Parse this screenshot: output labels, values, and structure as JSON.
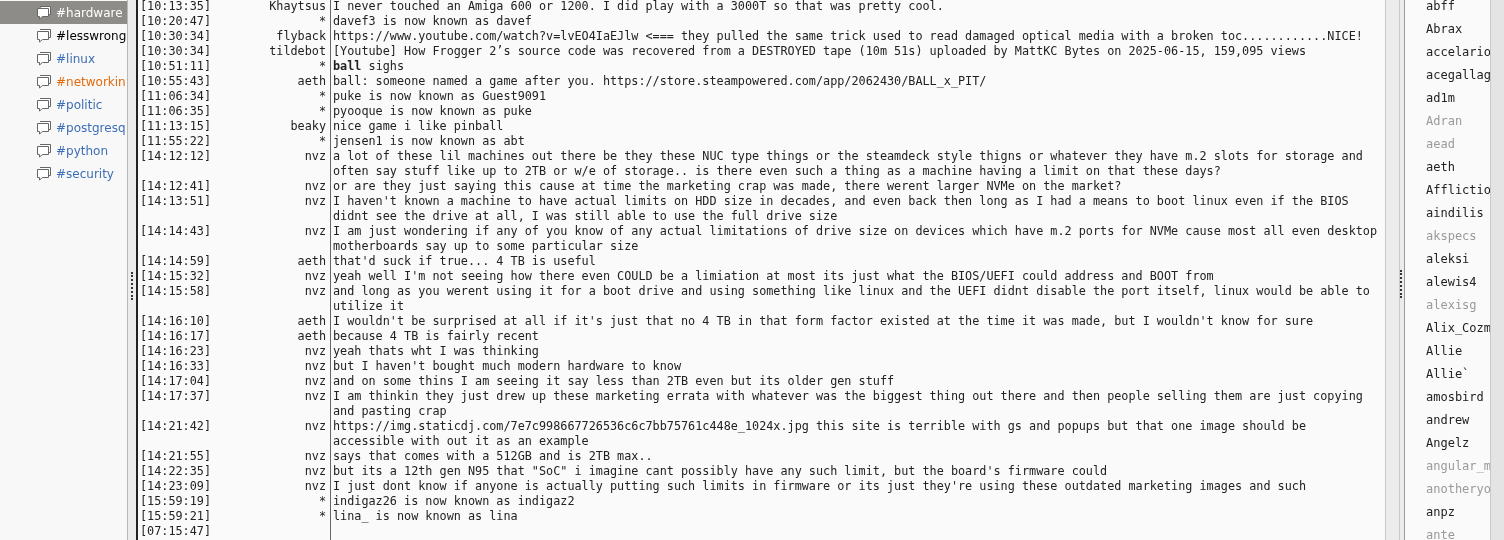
{
  "channels": [
    {
      "label": "#hardware",
      "selected": true,
      "color": "#ffffff"
    },
    {
      "label": "#lesswrong",
      "selected": false,
      "color": "#000000"
    },
    {
      "label": "#linux",
      "selected": false,
      "color": "#3d6fb6"
    },
    {
      "label": "#networkin",
      "selected": false,
      "color": "#e26a0a"
    },
    {
      "label": "#politic",
      "selected": false,
      "color": "#3d6fb6"
    },
    {
      "label": "#postgresq",
      "selected": false,
      "color": "#3d6fb6"
    },
    {
      "label": "#python",
      "selected": false,
      "color": "#3d6fb6"
    },
    {
      "label": "#security",
      "selected": false,
      "color": "#3d6fb6"
    }
  ],
  "messages": [
    {
      "time": "[10:13:35]",
      "nick": "Khaytsus",
      "text": "I never touched an Amiga 600 or 1200.  I did play with a 3000T so that was pretty cool."
    },
    {
      "time": "[10:20:47]",
      "nick": "*",
      "text": "davef3 is now known as davef"
    },
    {
      "time": "[10:30:34]",
      "nick": "flyback",
      "text": "https://www.youtube.com/watch?v=lvEO4IaEJlw <=== they pulled the same trick used to read damaged optical media with a broken toc............NICE!"
    },
    {
      "time": "[10:30:34]",
      "nick": "tildebot",
      "text": "[Youtube] How Frogger 2’s source code was recovered from a DESTROYED tape (10m 51s) uploaded by MattKC Bytes on 2025-06-15, 159,095 views"
    },
    {
      "time": "[10:51:11]",
      "nick": "*",
      "text": "**ball** sighs"
    },
    {
      "time": "[10:55:43]",
      "nick": "aeth",
      "text": "ball: someone named a game after you. https://store.steampowered.com/app/2062430/BALL_x_PIT/"
    },
    {
      "time": "[11:06:34]",
      "nick": "*",
      "text": "puke is now known as Guest9091"
    },
    {
      "time": "[11:06:35]",
      "nick": "*",
      "text": "pyooque is now known as puke"
    },
    {
      "time": "[11:13:15]",
      "nick": "beaky",
      "text": "nice game i like pinball"
    },
    {
      "time": "[11:55:22]",
      "nick": "*",
      "text": "jensen1 is now known as abt"
    },
    {
      "time": "[14:12:12]",
      "nick": "nvz",
      "text": "a lot of these lil machines out there be they these NUC type things or the steamdeck style thigns or whatever they have m.2 slots for storage and often say stuff like up to 2TB or w/e of storage.. is there even such a thing as a machine having a limit on that these days?"
    },
    {
      "time": "[14:12:41]",
      "nick": "nvz",
      "text": "or are they just saying this cause at time the marketing crap was made, there werent larger NVMe on the market?"
    },
    {
      "time": "[14:13:51]",
      "nick": "nvz",
      "text": "I haven't known a machine to have actual limits on HDD size in decades, and even back then long as I had a means to boot linux even if the BIOS didnt see the drive at all, I was still able to use the full drive size"
    },
    {
      "time": "[14:14:43]",
      "nick": "nvz",
      "text": "I am just wondering if any of you know of any actual limitations of drive size on devices which have m.2 ports for NVMe cause most all even desktop motherboards say up to some particular size"
    },
    {
      "time": "[14:14:59]",
      "nick": "aeth",
      "text": "that'd suck if true... 4 TB is useful"
    },
    {
      "time": "[14:15:32]",
      "nick": "nvz",
      "text": "yeah well I'm not seeing how there even COULD be a limiation at most its just what the BIOS/UEFI could address and BOOT from"
    },
    {
      "time": "[14:15:58]",
      "nick": "nvz",
      "text": "and long as you werent using it for a boot drive and using something like linux and the UEFI didnt disable the port itself, linux would be able to utilize it"
    },
    {
      "time": "[14:16:10]",
      "nick": "aeth",
      "text": "I wouldn't be surprised at all if it's just that no 4 TB in that form factor existed at the time it was made, but I wouldn't know for sure"
    },
    {
      "time": "[14:16:17]",
      "nick": "aeth",
      "text": "because 4 TB is fairly recent"
    },
    {
      "time": "[14:16:23]",
      "nick": "nvz",
      "text": "yeah thats wht I was thinking"
    },
    {
      "time": "[14:16:33]",
      "nick": "nvz",
      "text": "but I haven't bought much modern hardware to know"
    },
    {
      "time": "[14:17:04]",
      "nick": "nvz",
      "text": "and on some thins I am seeing it say less than 2TB even but its older gen stuff"
    },
    {
      "time": "[14:17:37]",
      "nick": "nvz",
      "text": "I am thinkin they just drew up these marketing errata with whatever was the biggest thing out there and then people selling them are just copying and pasting crap"
    },
    {
      "time": "[14:21:42]",
      "nick": "nvz",
      "text": "https://img.staticdj.com/7e7c998667726536c6c7bb75761c448e_1024x.jpg this site is terrible with gs and popups but that one image should be accessible with out it as an example"
    },
    {
      "time": "[14:21:55]",
      "nick": "nvz",
      "text": "says that comes with a 512GB and is 2TB max.."
    },
    {
      "time": "[14:22:35]",
      "nick": "nvz",
      "text": "but its a 12th gen N95 that \"SoC\" i imagine cant possibly have any such limit, but the board's firmware could"
    },
    {
      "time": "[14:23:09]",
      "nick": "nvz",
      "text": "I just dont know if anyone is actually putting such limits in firmware or its just they're using these outdated marketing images and such"
    },
    {
      "time": "[15:59:19]",
      "nick": "*",
      "text": "indigaz26 is now known as indigaz2"
    },
    {
      "time": "[15:59:21]",
      "nick": "*",
      "text": "lina_ is now known as lina"
    },
    {
      "time": "[07:15:47]"
    }
  ],
  "users": [
    {
      "nick": "abff",
      "away": false
    },
    {
      "nick": "Abrax",
      "away": false
    },
    {
      "nick": "accelario",
      "away": false
    },
    {
      "nick": "acegallag",
      "away": false
    },
    {
      "nick": "ad1m",
      "away": false
    },
    {
      "nick": "Adran",
      "away": true
    },
    {
      "nick": "aead",
      "away": true
    },
    {
      "nick": "aeth",
      "away": false
    },
    {
      "nick": "Afflictio",
      "away": false
    },
    {
      "nick": "aindilis",
      "away": false
    },
    {
      "nick": "akspecs",
      "away": true
    },
    {
      "nick": "aleksi",
      "away": false
    },
    {
      "nick": "alewis4",
      "away": false
    },
    {
      "nick": "alexisg",
      "away": true
    },
    {
      "nick": "Alix_Cozm",
      "away": false
    },
    {
      "nick": "Allie",
      "away": false
    },
    {
      "nick": "Allie`",
      "away": false
    },
    {
      "nick": "amosbird",
      "away": false
    },
    {
      "nick": "andrew",
      "away": false
    },
    {
      "nick": "Angelz",
      "away": false
    },
    {
      "nick": "angular_m",
      "away": true
    },
    {
      "nick": "anotheryo",
      "away": true
    },
    {
      "nick": "anpz",
      "away": false
    },
    {
      "nick": "ante",
      "away": true
    }
  ]
}
